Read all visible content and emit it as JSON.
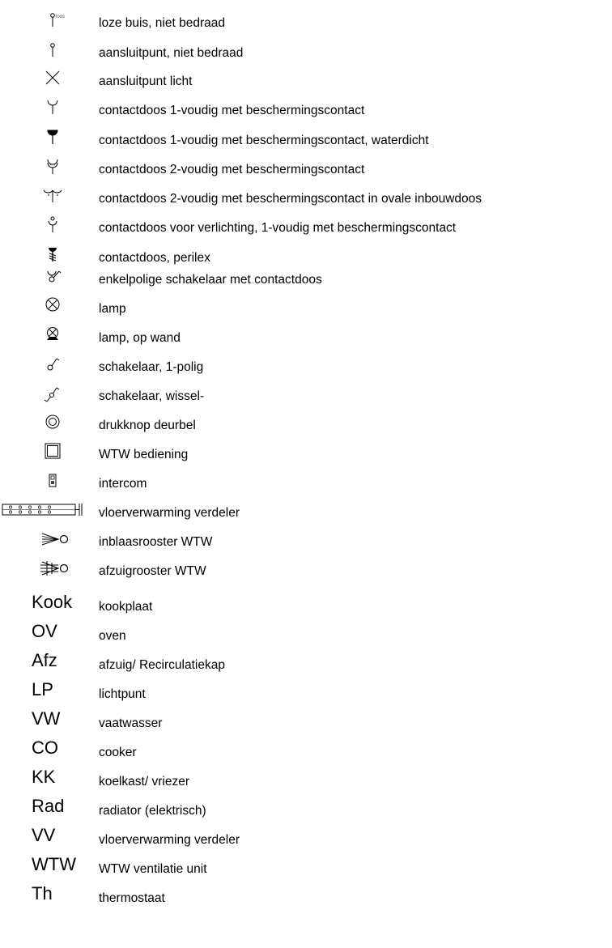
{
  "legend": {
    "symbol_rows": [
      {
        "icon": "loze-buis-icon",
        "label": "loze buis, niet bedraad",
        "tag": "loos"
      },
      {
        "icon": "aansluitpunt-icon",
        "label": "aansluitpunt, niet bedraad"
      },
      {
        "icon": "aansluitpunt-licht-icon",
        "label": "aansluitpunt licht"
      },
      {
        "icon": "contactdoos-1-icon",
        "label": "contactdoos 1-voudig met beschermingscontact"
      },
      {
        "icon": "contactdoos-waterdicht-icon",
        "label": "contactdoos 1-voudig met beschermingscontact, waterdicht"
      },
      {
        "icon": "contactdoos-2-icon",
        "label": "contactdoos 2-voudig met beschermingscontact"
      },
      {
        "icon": "contactdoos-2-ovaal-icon",
        "label": "contactdoos 2-voudig met beschermingscontact in ovale inbouwdoos"
      },
      {
        "icon": "contactdoos-verlichting-icon",
        "label": "contactdoos voor verlichting, 1-voudig met beschermingscontact"
      },
      {
        "icon": "perilex-icon",
        "label": "contactdoos, perilex"
      },
      {
        "icon": "schakelaar-contactdoos-icon",
        "label": "enkelpolige schakelaar met contactdoos"
      },
      {
        "icon": "lamp-icon",
        "label": "lamp"
      },
      {
        "icon": "lamp-wand-icon",
        "label": "lamp, op wand"
      },
      {
        "icon": "schakelaar-1-polig-icon",
        "label": "schakelaar, 1-polig"
      },
      {
        "icon": "schakelaar-wissel-icon",
        "label": "schakelaar, wissel-"
      },
      {
        "icon": "drukknop-deurbel-icon",
        "label": "drukknop deurbel"
      },
      {
        "icon": "wtw-bediening-icon",
        "label": "WTW bediening"
      },
      {
        "icon": "intercom-icon",
        "label": "intercom"
      },
      {
        "icon": "vloerverwarming-verdeler-icon",
        "label": "vloerverwarming verdeler"
      },
      {
        "icon": "inblaasrooster-icon",
        "label": "inblaasrooster WTW"
      },
      {
        "icon": "afzuigrooster-icon",
        "label": "afzuigrooster WTW"
      }
    ],
    "abbreviation_rows": [
      {
        "abbr": "Kook",
        "label": "kookplaat"
      },
      {
        "abbr": "OV",
        "label": "oven"
      },
      {
        "abbr": "Afz",
        "label": "afzuig/ Recirculatiekap"
      },
      {
        "abbr": "LP",
        "label": "lichtpunt"
      },
      {
        "abbr": "VW",
        "label": "vaatwasser"
      },
      {
        "abbr": "CO",
        "label": "cooker"
      },
      {
        "abbr": "KK",
        "label": "koelkast/ vriezer"
      },
      {
        "abbr": "Rad",
        "label": "radiator (elektrisch)"
      },
      {
        "abbr": "VV",
        "label": "vloerverwarming verdeler"
      },
      {
        "abbr": "WTW",
        "label": "WTW ventilatie unit"
      },
      {
        "abbr": "Th",
        "label": "thermostaat"
      }
    ]
  }
}
